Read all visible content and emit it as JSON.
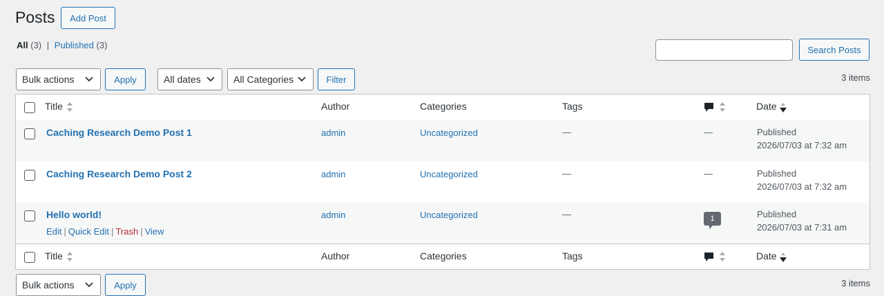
{
  "header": {
    "title": "Posts",
    "add_button": "Add Post"
  },
  "views": {
    "all_label": "All",
    "all_count": "(3)",
    "separator": "|",
    "published_label": "Published",
    "published_count": "(3)"
  },
  "search": {
    "value": "",
    "button": "Search Posts"
  },
  "filters": {
    "bulk_actions": "Bulk actions",
    "apply": "Apply",
    "dates": "All dates",
    "categories": "All Categories",
    "filter": "Filter"
  },
  "items_count": "3 items",
  "table": {
    "columns": {
      "title": "Title",
      "author": "Author",
      "categories": "Categories",
      "tags": "Tags",
      "date": "Date"
    },
    "rows": [
      {
        "title": "Caching Research Demo Post 1",
        "author": "admin",
        "category": "Uncategorized",
        "tags": "—",
        "comments": "—",
        "status": "Published",
        "date": "2026/07/03 at 7:32 am"
      },
      {
        "title": "Caching Research Demo Post 2",
        "author": "admin",
        "category": "Uncategorized",
        "tags": "—",
        "comments": "—",
        "status": "Published",
        "date": "2026/07/03 at 7:32 am"
      },
      {
        "title": "Hello world!",
        "author": "admin",
        "category": "Uncategorized",
        "tags": "—",
        "comments": "1",
        "status": "Published",
        "date": "2026/07/03 at 7:31 am",
        "actions": {
          "edit": "Edit",
          "quick_edit": "Quick Edit",
          "trash": "Trash",
          "view": "View",
          "sep": "|"
        }
      }
    ]
  },
  "colors": {
    "accent": "#2271b1",
    "trash": "#b32d2e",
    "background": "#f0f0f1",
    "border": "#c3c4c7"
  }
}
